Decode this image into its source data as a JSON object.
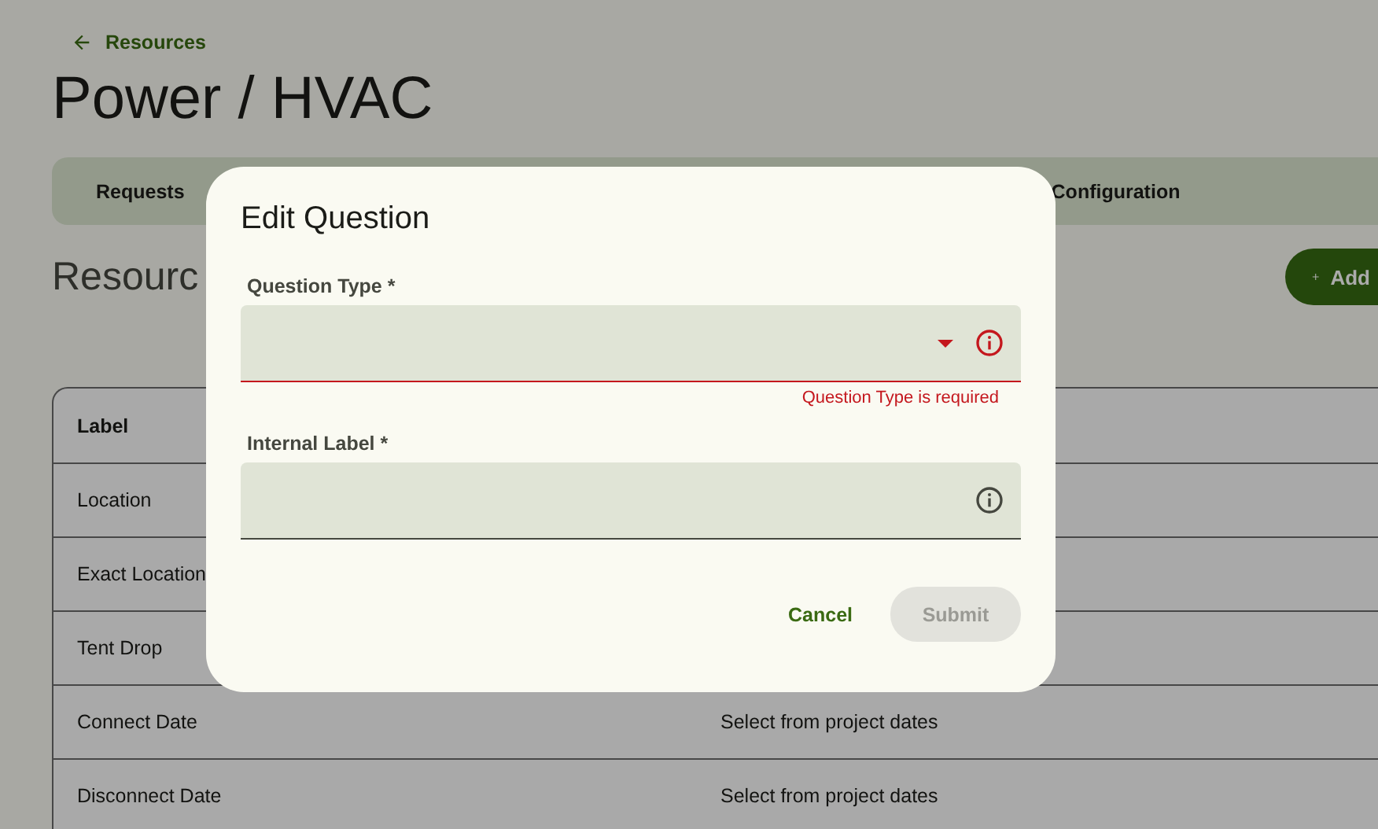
{
  "back_link": {
    "label": "Resources"
  },
  "page_title": "Power / HVAC",
  "tabs": [
    {
      "label": "Requests"
    },
    {
      "label": "Configuration"
    }
  ],
  "section_title": "Resourc",
  "add_button": {
    "label": "Add"
  },
  "table": {
    "columns": [
      "Label"
    ],
    "rows": [
      {
        "cells": [
          "Location",
          ""
        ]
      },
      {
        "cells": [
          "Exact Location",
          ""
        ]
      },
      {
        "cells": [
          "Tent Drop",
          ""
        ]
      },
      {
        "cells": [
          "Connect Date",
          "Select from project dates"
        ]
      },
      {
        "cells": [
          "Disconnect Date",
          "Select from project dates"
        ]
      }
    ]
  },
  "dialog": {
    "title": "Edit Question",
    "fields": [
      {
        "kind": "select",
        "label": "Question Type *",
        "error": "Question Type is required"
      },
      {
        "kind": "text",
        "label": "Internal Label *"
      }
    ],
    "buttons": [
      {
        "label": "Cancel",
        "kind": "text"
      },
      {
        "label": "Submit",
        "kind": "filled",
        "disabled": true
      }
    ]
  }
}
